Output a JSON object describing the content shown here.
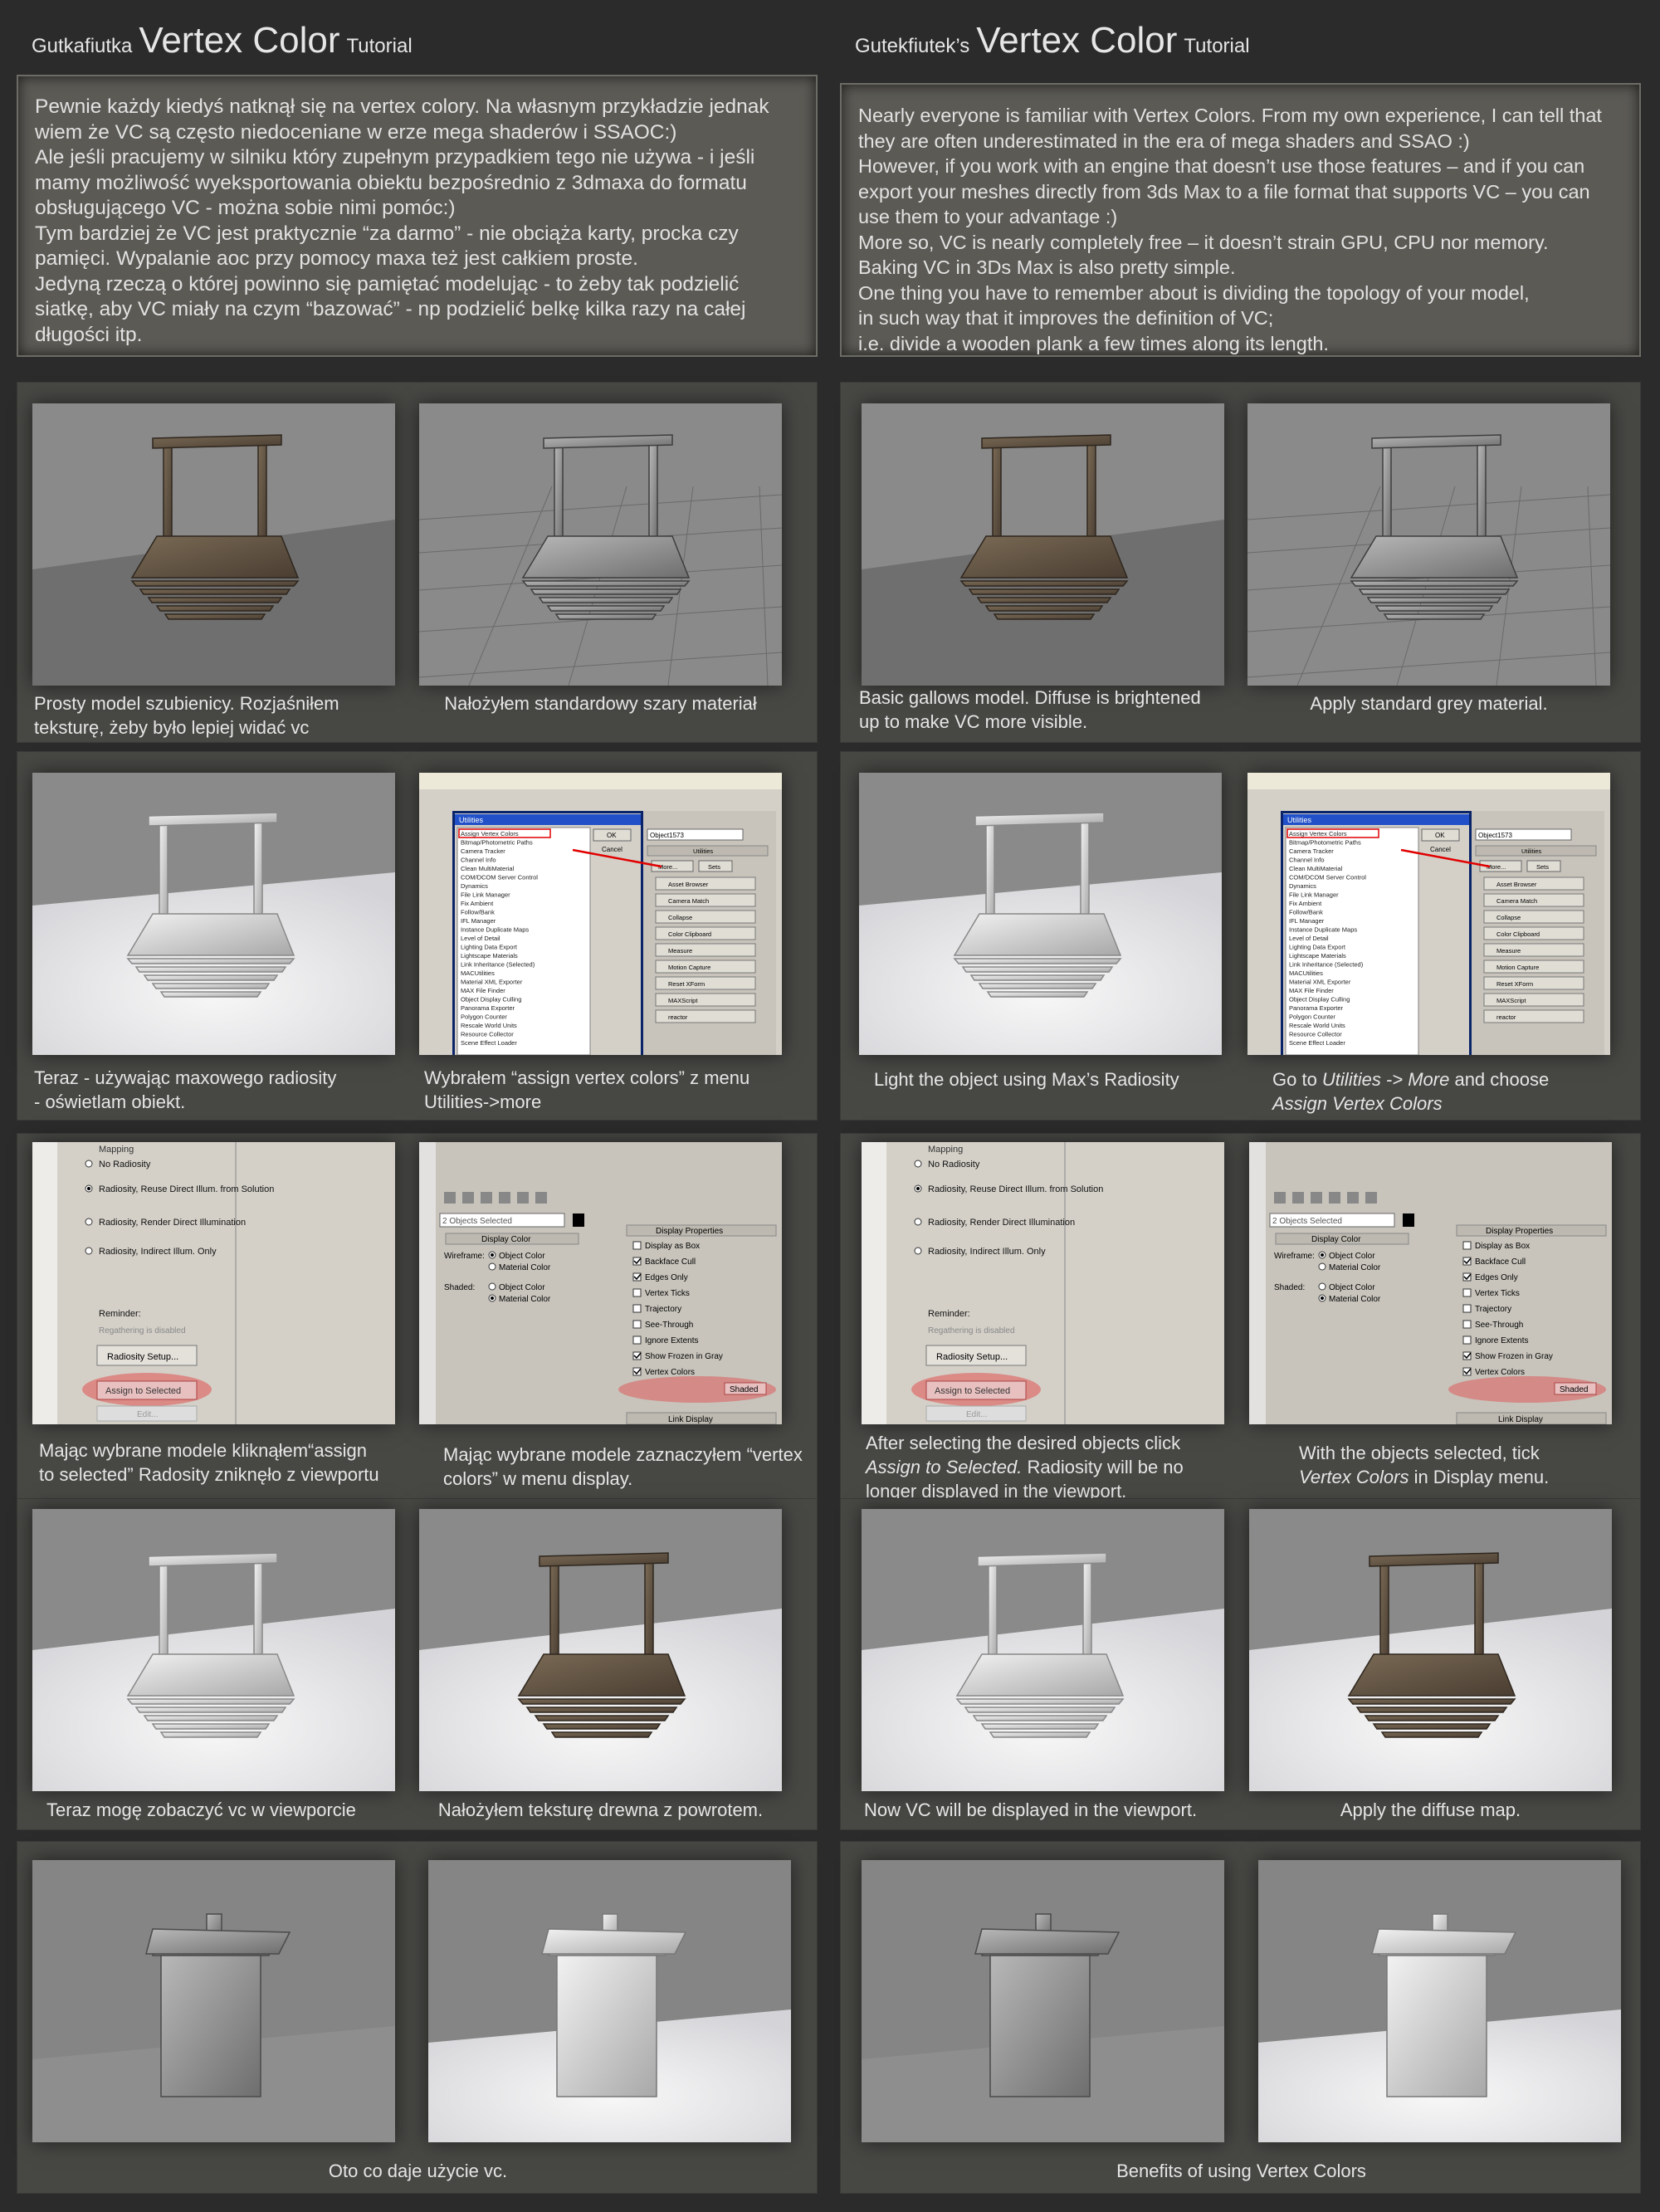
{
  "polish": {
    "title": {
      "prefix": "Gutkafiutka",
      "main": "Vertex Color",
      "suffix": "Tutorial"
    },
    "intro": [
      "Pewnie każdy kiedyś natknął się na vertex colory. Na własnym przykładzie jednak",
      "wiem że VC są często niedoceniane w erze mega shaderów i SSAOC:)",
      "Ale jeśli pracujemy w silniku który zupełnym przypadkiem tego nie używa -  i jeśli",
      "mamy możliwość wyeksportowania obiektu bezpośrednio z 3dmaxa do formatu",
      "obsługującego VC - można sobie nimi pomóc:)",
      "Tym bardziej że VC jest praktycznie “za darmo” - nie obciąża karty, procka czy",
      "pamięci. Wypalanie aoc przy pomocy maxa też jest całkiem proste.",
      "Jedyną rzeczą o której powinno się pamiętać modelując - to żeby tak podzielić",
      "siatkę, aby VC miały na czym “bazować” - np podzielić belkę kilka razy na całej",
      "długości itp."
    ],
    "captions": {
      "s1a": [
        "Prosty model szubienicy. Rozjaśniłem",
        "teksturę, żeby było lepiej widać vc"
      ],
      "s1b": [
        "Nałożyłem standardowy szary materiał"
      ],
      "s2a": [
        "Teraz - używając maxowego radiosity",
        "- oświetlam obiekt."
      ],
      "s2b": [
        "Wybrałem “assign vertex colors” z menu",
        "Utilities->more"
      ],
      "s3a": [
        "Mając wybrane modele kliknąłem“assign",
        "to selected” Radosity zniknęło z viewportu"
      ],
      "s3b": [
        "Mając wybrane modele zaznaczyłem “vertex",
        "colors” w menu display."
      ],
      "s4a": [
        "Teraz mogę zobaczyć vc w viewporcie"
      ],
      "s4b": [
        "Nałożyłem teksturę drewna z powrotem."
      ],
      "s5": [
        "Oto co daje użycie vc."
      ]
    }
  },
  "english": {
    "title": {
      "prefix": "Gutekfiutek’s",
      "main": "Vertex Color",
      "suffix": "Tutorial"
    },
    "intro": [
      "Nearly everyone is familiar with Vertex Colors. From my own experience, I can tell that",
      "they are often underestimated in the era of mega shaders and SSAO :)",
      "However, if you work with an engine that doesn’t use those features – and if you can",
      "export your meshes directly from 3ds Max to a file format that supports VC – you can",
      "use them to your advantage :)",
      "More so, VC is nearly completely free – it doesn’t strain GPU, CPU nor memory.",
      "Baking VC in 3Ds Max is also pretty simple.",
      "One thing you have to remember about is dividing the topology of your model,",
      "in such way that it improves the definition of VC;",
      "i.e. divide a wooden plank a few times along its length."
    ],
    "captions": {
      "s1a": [
        "Basic gallows model. Diffuse is brightened",
        "up to make VC more visible."
      ],
      "s1b": [
        "Apply standard grey material."
      ],
      "s2a": [
        "Light the object using Max’s Radiosity"
      ],
      "s2b_1_pre": "Go to ",
      "s2b_1_em": "Utilities -> More",
      "s2b_1_post": " and choose",
      "s2b_2_em": "Assign Vertex Colors",
      "s3a_1": "After selecting the desired objects click",
      "s3a_2_em": "Assign to Selected.",
      "s3a_2_post": " Radiosity will be no",
      "s3a_3": "longer displayed in the viewport.",
      "s3b_1": "With the objects selected, tick",
      "s3b_2_em": "Vertex Colors",
      "s3b_2_post": " in Display menu.",
      "s4a": [
        "Now VC will be displayed in the viewport."
      ],
      "s4b": [
        "Apply the diffuse map."
      ],
      "s5": [
        "Benefits of using Vertex Colors"
      ]
    }
  },
  "ui_texts": {
    "utilities": {
      "window_title": "Utilities",
      "list": [
        "Assign Vertex Colors",
        "Bitmap/Photometric Paths",
        "Camera Tracker",
        "Channel Info",
        "Clean MultiMaterial",
        "COM/DCOM Server Control",
        "Dynamics",
        "File Link Manager",
        "Fix Ambient",
        "Follow/Bank",
        "IFL Manager",
        "Instance Duplicate Maps",
        "Level of Detail",
        "Lighting Data Export",
        "Lightscape Materials",
        "Link Inheritance (Selected)",
        "MACUtilities",
        "Material XML Exporter",
        "MAX File Finder",
        "Object Display Culling",
        "Panorama Exporter",
        "Polygon Counter",
        "Rescale World Units",
        "Resource Collector",
        "Scene Effect Loader"
      ],
      "ok": "OK",
      "cancel": "Cancel",
      "object_name": "Object1573",
      "panel_title": "Utilities",
      "more": "More...",
      "sets": "Sets",
      "buttons": [
        "Asset Browser",
        "Camera Match",
        "Collapse",
        "Color Clipboard",
        "Measure",
        "Motion Capture",
        "Reset XForm",
        "MAXScript",
        "reactor"
      ]
    },
    "radiosity": {
      "mapping": "Mapping",
      "options": [
        "No Radiosity",
        "Radiosity, Reuse Direct Illum. from Solution",
        "Radiosity, Render Direct Illumination",
        "Radiosity, Indirect Illum. Only"
      ],
      "reminder": "Reminder:",
      "regather": "Regathering is disabled",
      "setup_button": "Radiosity Setup...",
      "assign_button": "Assign to Selected",
      "edit_button": "Edit..."
    },
    "display": {
      "objects_selected": "2 Objects Selected",
      "display_color": "Display Color",
      "wireframe": "Wireframe:",
      "shaded": "Shaded:",
      "object_color": "Object Color",
      "material_color": "Material Color",
      "display_properties": "Display Properties",
      "props": [
        "Display as Box",
        "Backface Cull",
        "Edges Only",
        "Vertex Ticks",
        "Trajectory",
        "See-Through",
        "Ignore Extents",
        "Show Frozen in Gray",
        "Vertex Colors"
      ],
      "checked": [
        false,
        true,
        true,
        false,
        false,
        false,
        false,
        true,
        true
      ],
      "shaded_button": "Shaded",
      "link_display": "Link Display"
    }
  },
  "colors": {
    "background": "#2b2b2b",
    "intro_panel": "#5b5a55",
    "section_panel": "#474744",
    "highlight_red": "#e05050",
    "viewport_grey": "#8a8a8a"
  }
}
